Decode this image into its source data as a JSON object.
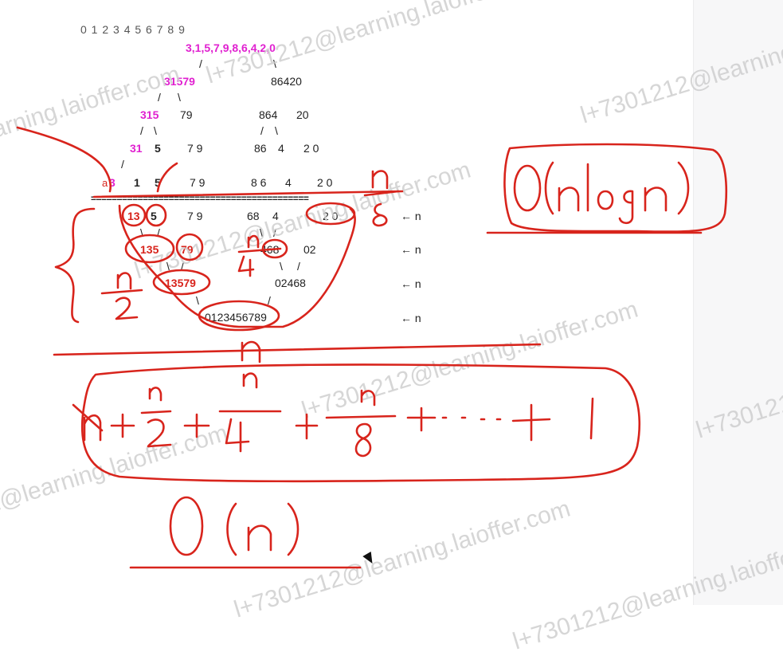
{
  "index_row": "0 1 2 3 4 5 6 7 8 9",
  "split_tree": {
    "root": "3,1,5,7,9,8,6,4,2,0",
    "level1_left": "31579",
    "level1_right": "86420",
    "level2_left_a": "315",
    "level2_left_b": "79",
    "level2_right_a": "864",
    "level2_right_b": "20",
    "level3_a": "31",
    "level3_b": "5",
    "level3_c": "7 9",
    "level3_d": "86",
    "level3_e": "4",
    "level3_f": "2 0",
    "level4_a": "3",
    "level4_b": "1",
    "level4_c": "5",
    "level4_d": "7 9",
    "level4_e": "8 6",
    "level4_f": "4",
    "level4_g": "2 0"
  },
  "separator": "==========================================",
  "merge_tree": {
    "row1_a": "13",
    "row1_b": "5",
    "row1_c": "7 9",
    "row1_d": "68",
    "row1_e": "4",
    "row1_f": "2 0",
    "row2_a": "135",
    "row2_b": "79",
    "row2_c": "468",
    "row2_d": "02",
    "row3_a": "13579",
    "row3_b": "02468",
    "row4": "0123456789"
  },
  "row_costs": [
    "← n",
    "← n",
    "← n",
    "← n"
  ],
  "annotations": {
    "n_over_8": "n/8",
    "n_over_4": "n/4",
    "n_over_2": "n/2",
    "n_bottom": "n",
    "total_nlogn": "O(n logn)",
    "sum_series": "n + n/2 + n/4 + n/8 + ... + 1",
    "total_n": "O(n)"
  },
  "watermark": "l+7301212@learning.laioffer.com",
  "colors": {
    "ink": "#d8241c",
    "pink": "#e020d0",
    "text": "#222222",
    "watermark": "#cfcfcf"
  }
}
